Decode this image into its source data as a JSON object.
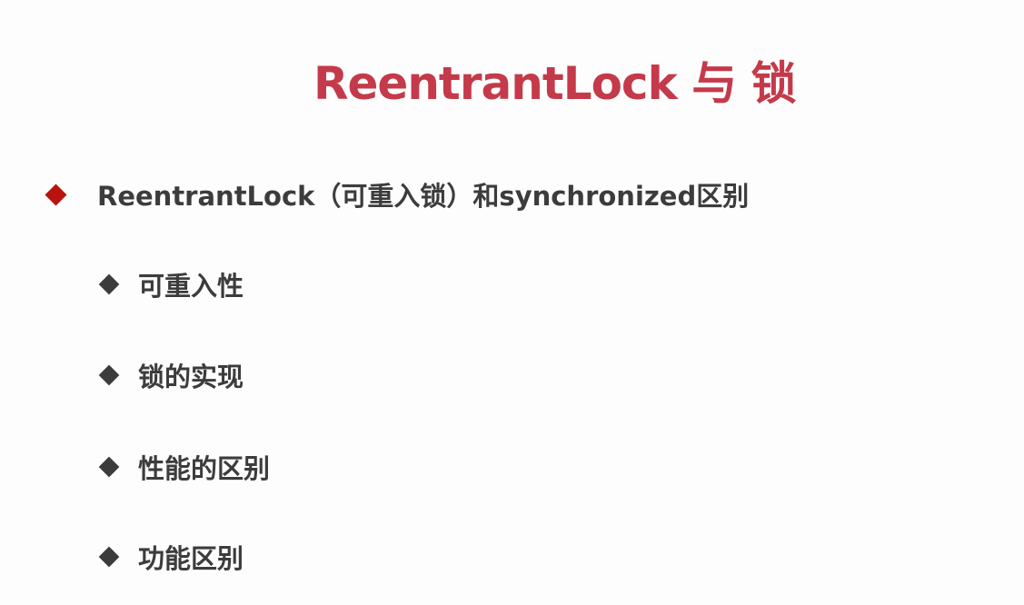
{
  "slide": {
    "title": "ReentrantLock 与 锁",
    "main_bullet": "ReentrantLock（可重入锁）和synchronized区别",
    "sub_bullets": [
      "可重入性",
      "锁的实现",
      "性能的区别",
      "功能区别"
    ],
    "colors": {
      "title": "#c43a4a",
      "main_diamond": "#b8130f",
      "text": "#3c3c3c"
    }
  }
}
